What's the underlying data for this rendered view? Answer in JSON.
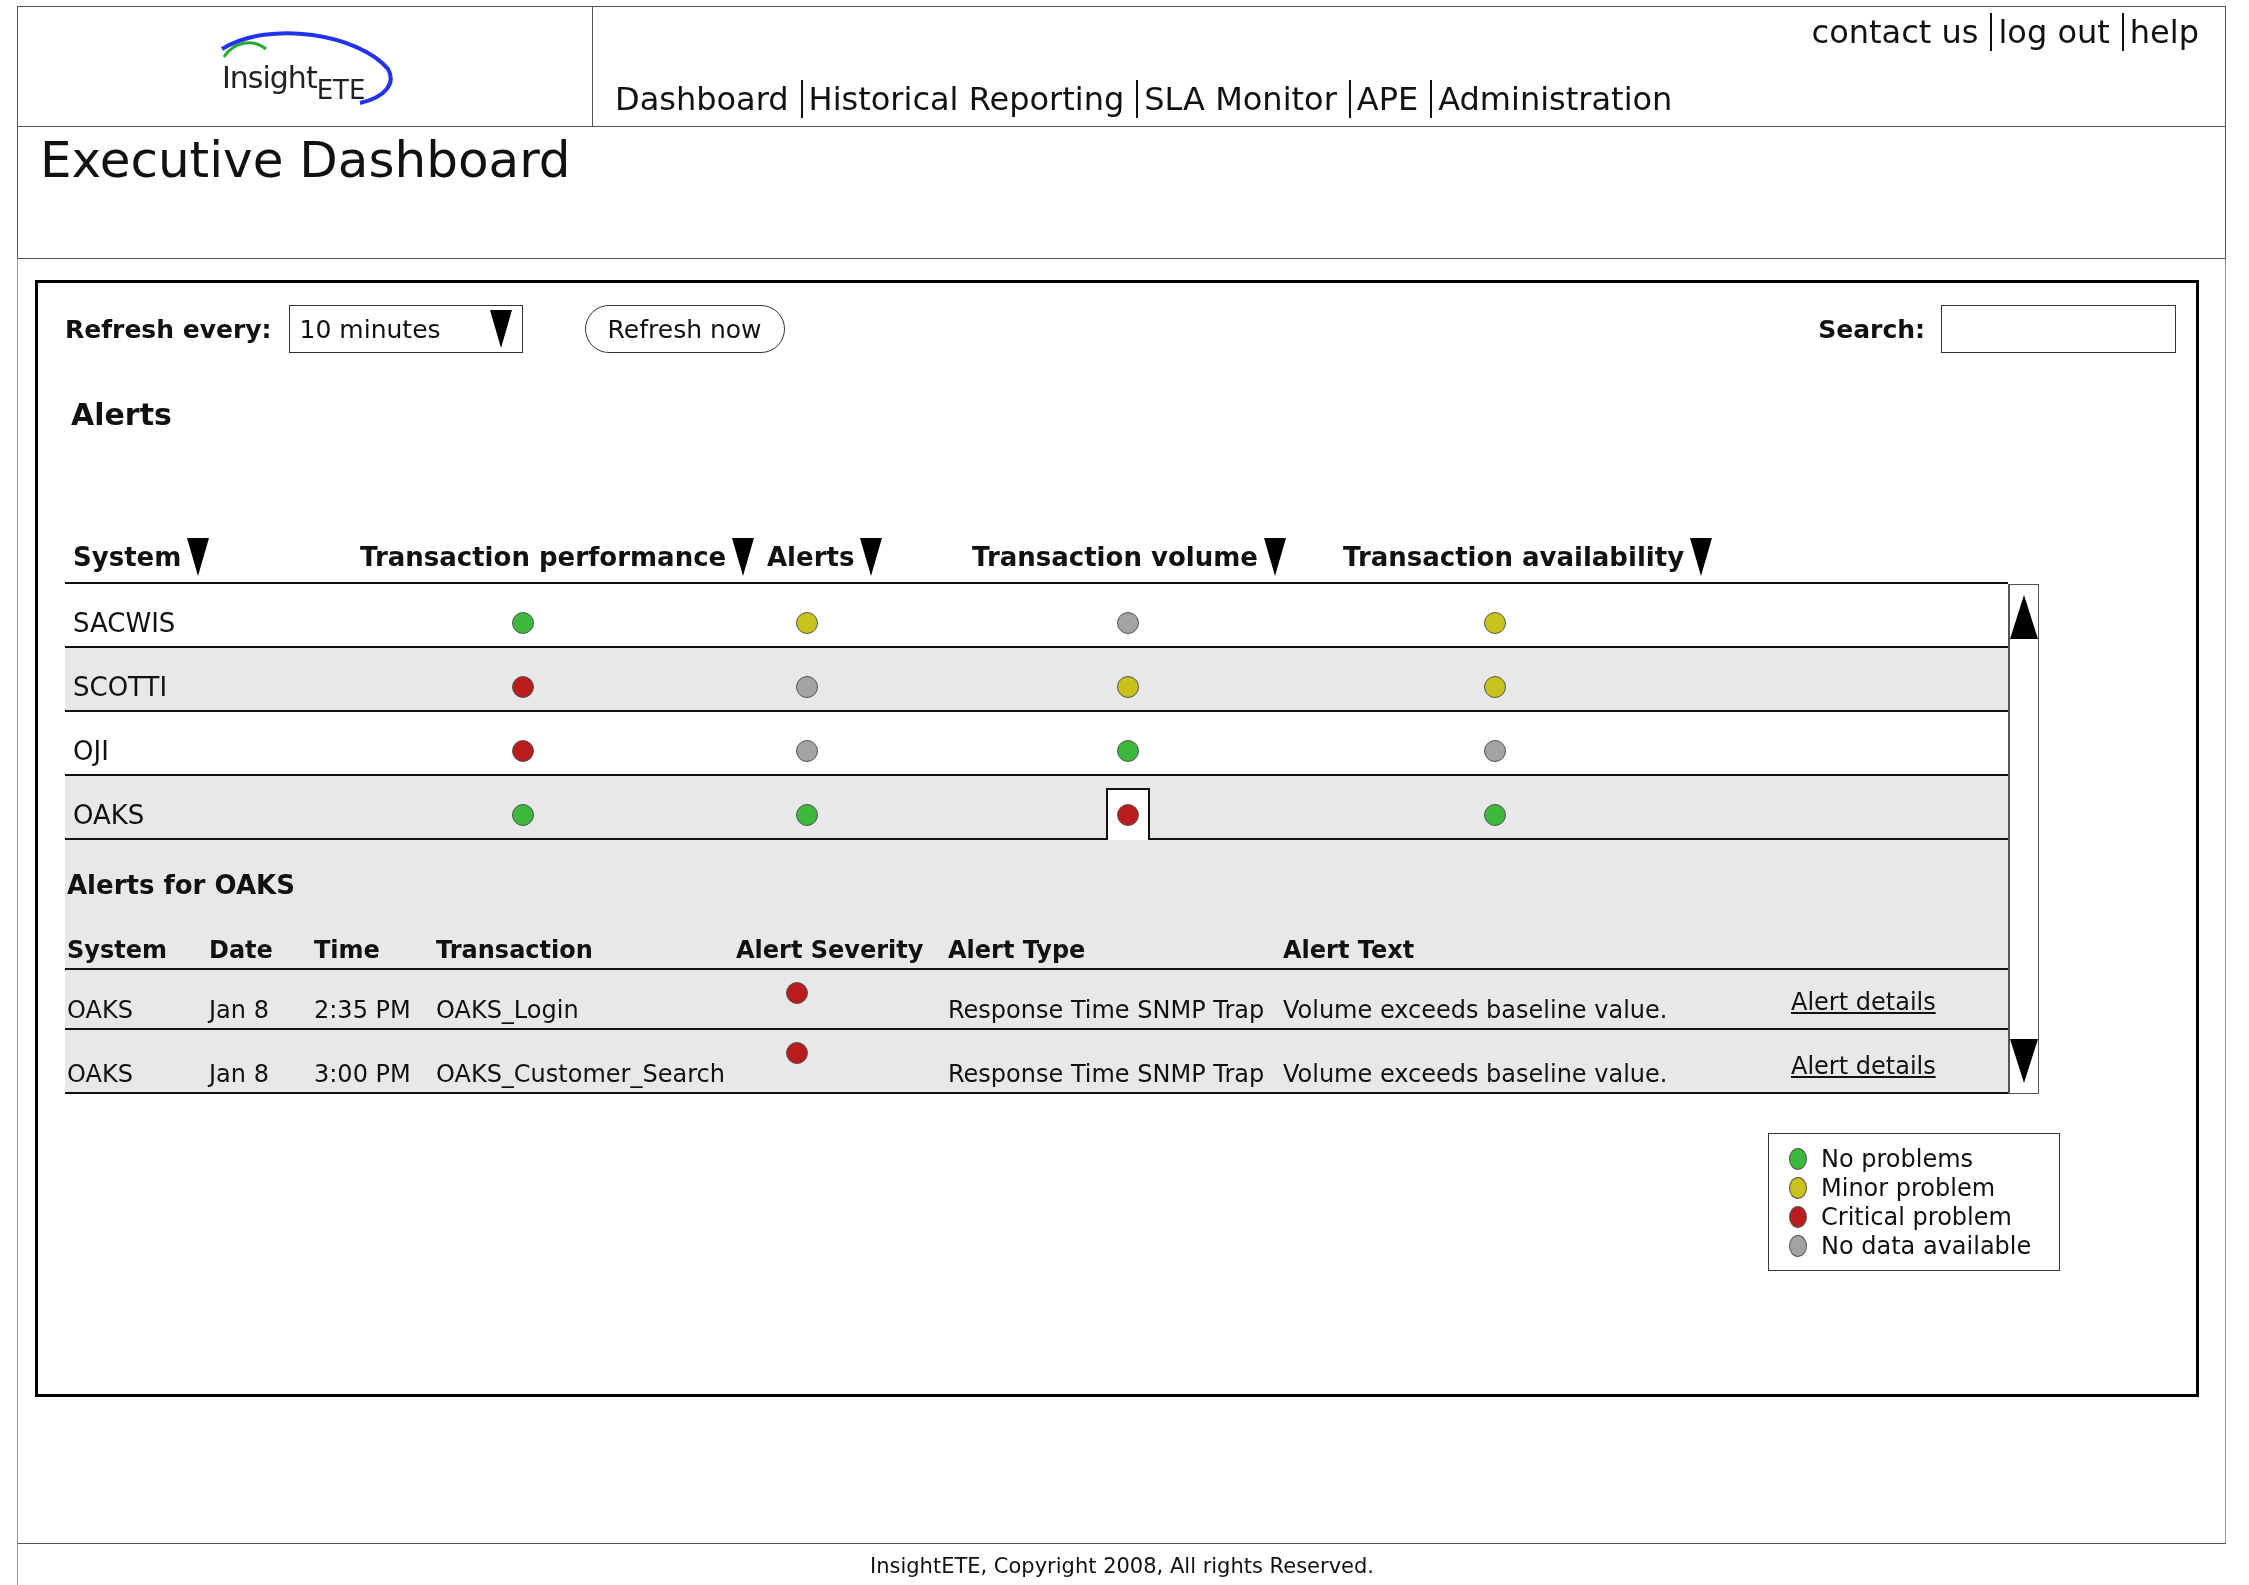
{
  "header": {
    "logo": {
      "word": "Insight",
      "sub": "ETE"
    },
    "utility_links": [
      "contact us",
      "log out",
      "help"
    ],
    "nav": [
      "Dashboard",
      "Historical Reporting",
      "SLA Monitor",
      "APE",
      "Administration"
    ]
  },
  "page_title": "Executive Dashboard",
  "toolbar": {
    "refresh_label": "Refresh every:",
    "refresh_value": "10 minutes",
    "refresh_button": "Refresh now",
    "search_label": "Search:"
  },
  "alerts_title": "Alerts",
  "columns": [
    "System",
    "Transaction performance",
    "Alerts",
    "Transaction volume",
    "Transaction availability"
  ],
  "rows": [
    {
      "system": "SACWIS",
      "cells": [
        {
          "color": "#3cb83c",
          "selected": false
        },
        {
          "color": "#c9c21c",
          "selected": false
        },
        {
          "color": "#a3a3a3",
          "selected": false
        },
        {
          "color": "#c9c21c",
          "selected": false
        }
      ]
    },
    {
      "system": "SCOTTI",
      "cells": [
        {
          "color": "#b81c1c",
          "selected": false
        },
        {
          "color": "#a3a3a3",
          "selected": false
        },
        {
          "color": "#c9c21c",
          "selected": false
        },
        {
          "color": "#c9c21c",
          "selected": false
        }
      ]
    },
    {
      "system": "OJI",
      "cells": [
        {
          "color": "#b81c1c",
          "selected": false
        },
        {
          "color": "#a3a3a3",
          "selected": false
        },
        {
          "color": "#3cb83c",
          "selected": false
        },
        {
          "color": "#a3a3a3",
          "selected": false
        }
      ]
    },
    {
      "system": "OAKS",
      "cells": [
        {
          "color": "#3cb83c",
          "selected": false
        },
        {
          "color": "#3cb83c",
          "selected": false
        },
        {
          "color": "#b81c1c",
          "selected": true
        },
        {
          "color": "#3cb83c",
          "selected": false
        }
      ]
    }
  ],
  "detail": {
    "title": "Alerts for OAKS",
    "columns": [
      "System",
      "Date",
      "Time",
      "Transaction",
      "Alert Severity",
      "Alert Type",
      "Alert Text"
    ],
    "rows": [
      {
        "system": "OAKS",
        "date": "Jan 8",
        "time": "2:35 PM",
        "transaction": "OAKS_Login",
        "color": "#b81c1c",
        "type": "Response Time SNMP Trap",
        "text": "Volume exceeds baseline value.",
        "link": "Alert details"
      },
      {
        "system": "OAKS",
        "date": "Jan 8",
        "time": "3:00 PM",
        "transaction": "OAKS_Customer_Search",
        "color": "#b81c1c",
        "type": "Response Time SNMP Trap",
        "text": "Volume exceeds baseline value.",
        "link": "Alert details"
      }
    ]
  },
  "legend": [
    {
      "color": "#3cb83c",
      "label": "No problems"
    },
    {
      "color": "#c9c21c",
      "label": "Minor problem"
    },
    {
      "color": "#b81c1c",
      "label": "Critical problem"
    },
    {
      "color": "#a3a3a3",
      "label": "No data available"
    }
  ],
  "footer": "InsightETE, Copyright 2008, All rights Reserved."
}
